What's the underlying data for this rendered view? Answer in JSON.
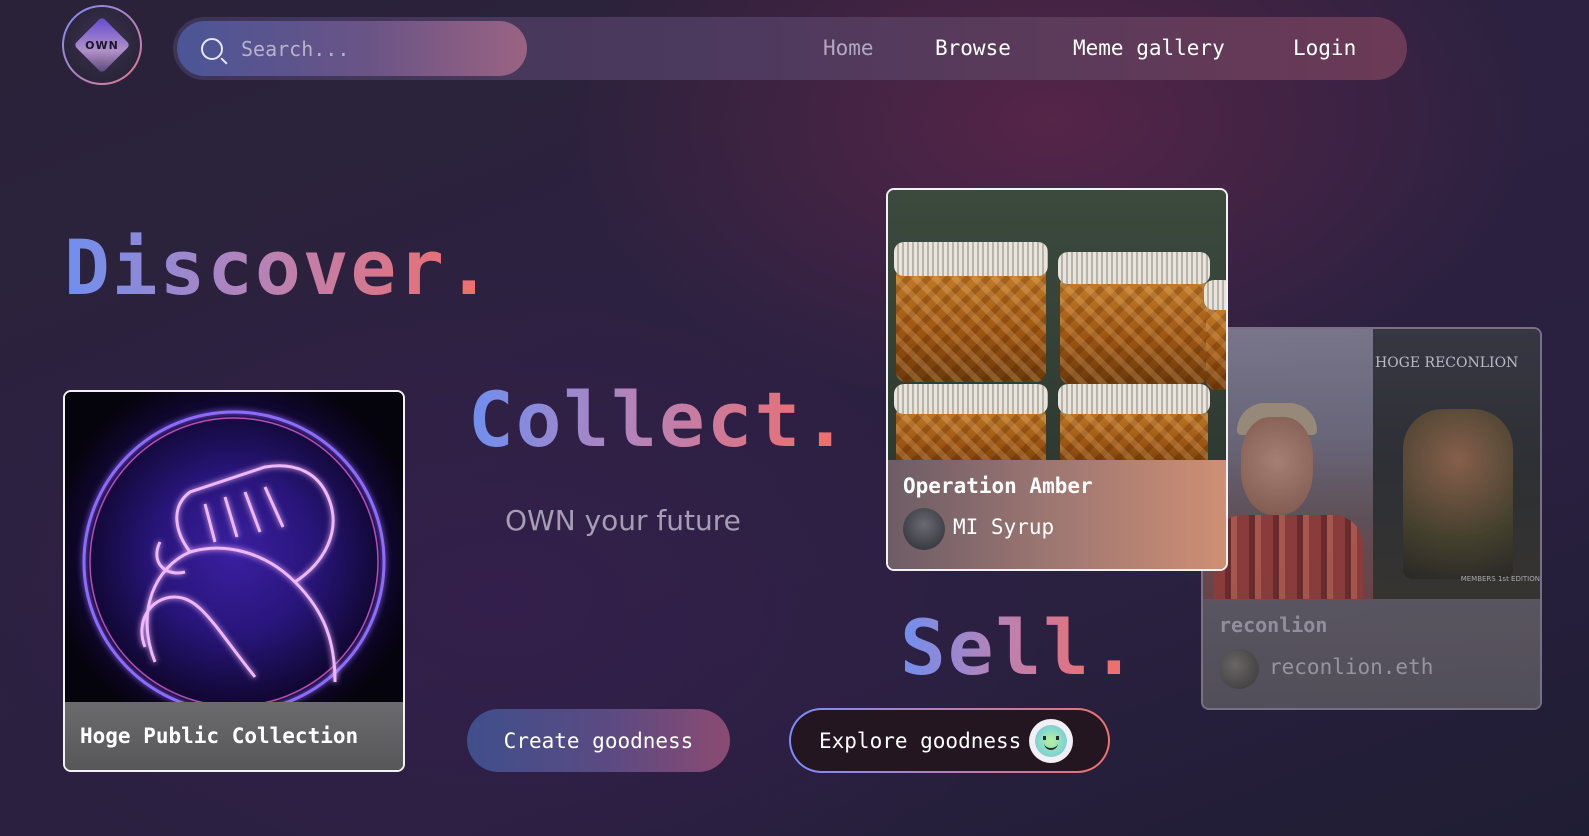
{
  "brand": {
    "logo_text": "OWN"
  },
  "search": {
    "placeholder": "Search..."
  },
  "nav": {
    "items": [
      {
        "label": "Home",
        "active": true
      },
      {
        "label": "Browse"
      },
      {
        "label": "Meme gallery"
      },
      {
        "label": "Login"
      }
    ]
  },
  "hero": {
    "discover": "Discover",
    "collect": "Collect",
    "sell": "Sell",
    "dot": ".",
    "tagline": "OWN your future"
  },
  "cards": {
    "hoge": {
      "title": "Hoge Public Collection"
    },
    "amber": {
      "title": "Operation Amber",
      "creator": "MI Syrup"
    },
    "reconlion": {
      "title": "reconlion",
      "creator": "reconlion.eth",
      "image_banner": "HOGE RECONLION",
      "image_sub": "MEMBERS 1st EDITION"
    }
  },
  "buttons": {
    "create": "Create goodness",
    "explore": "Explore goodness"
  },
  "colors": {
    "accent_blue": "#6f8ff0",
    "accent_coral": "#ee6f6f",
    "background": "#2a2238"
  },
  "icons": {
    "search": "search-icon",
    "explore": "smiley-icon"
  }
}
